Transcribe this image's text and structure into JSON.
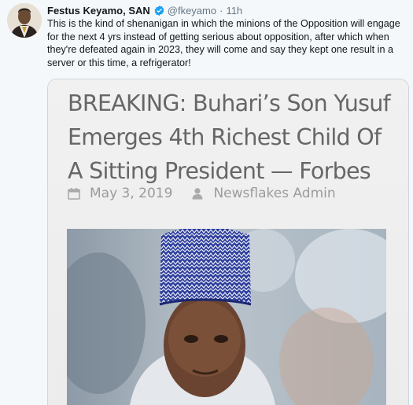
{
  "tweet": {
    "author_name": "Festus Keyamo, SAN",
    "handle": "@fkeyamo",
    "separator": "·",
    "time": "11h",
    "text": "This is the kind of shenanigan in which the minions of the Opposition will engage for the next 4 yrs instead of getting serious about opposition, after which when they're defeated again in 2023, they will come and say they kept one result in a server or this time, a refrigerator!"
  },
  "media": {
    "headline": "BREAKING: Buhari’s Son Yusuf Emerges 4th Richest Child Of A Sitting President — Forbes",
    "date": "May 3, 2019",
    "author": "Newsflakes Admin"
  },
  "icons": {
    "verified": "verified-badge-icon",
    "calendar": "calendar-icon",
    "user": "user-icon"
  },
  "colors": {
    "verified_blue": "#1da1f2",
    "headline_gray": "#666666",
    "meta_gray": "#9b9b9b",
    "cap_blue": "#2c3d9c"
  }
}
